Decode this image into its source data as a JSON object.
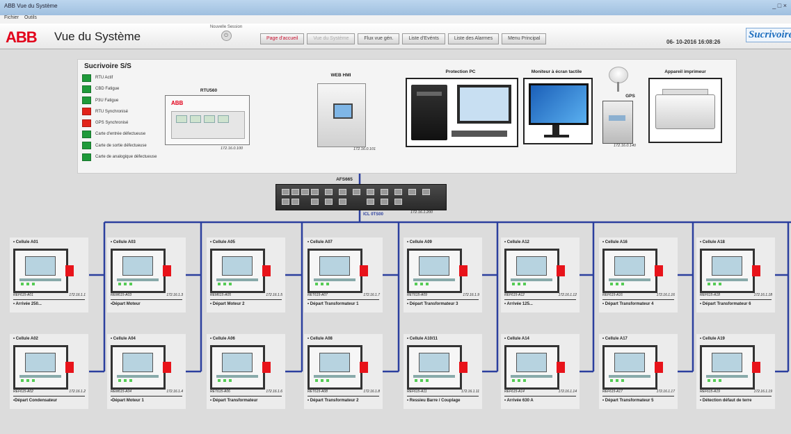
{
  "window": {
    "title": "ABB Vue du Système",
    "controls": "_ □ ×"
  },
  "menu": {
    "items": [
      "Fichier",
      "Outils"
    ]
  },
  "header": {
    "logo": "ABB",
    "title": "Vue du Système",
    "login_label": "Nouvelle Session",
    "datetime": "06- 10-2016 16:08:26",
    "brand": "Sucrivoire"
  },
  "nav": [
    {
      "label": "Page d'accueil",
      "state": "active"
    },
    {
      "label": "Vue du Système",
      "state": "dim"
    },
    {
      "label": "Flux vue gén.",
      "state": "normal"
    },
    {
      "label": "Liste d'Evénts",
      "state": "normal"
    },
    {
      "label": "Liste des Alarmes",
      "state": "normal"
    },
    {
      "label": "Menu Principal",
      "state": "normal"
    }
  ],
  "status_panel": {
    "title": "Sucrivoire S/S",
    "items": [
      {
        "label": "RTU Actif",
        "color": "#1f9a3a"
      },
      {
        "label": "CBD Fatigue",
        "color": "#1f9a3a"
      },
      {
        "label": "P3U Fatigue",
        "color": "#1f9a3a"
      },
      {
        "label": "RTU Synchronisé",
        "color": "#e2231a"
      },
      {
        "label": "GPS Synchronisé",
        "color": "#e2231a"
      },
      {
        "label": "Carte d'entrée défectueuse",
        "color": "#1f9a3a"
      },
      {
        "label": "Carte de sortie défectueuse",
        "color": "#1f9a3a"
      },
      {
        "label": "Carte de analogique défectueuse",
        "color": "#1f9a3a"
      }
    ]
  },
  "devices": {
    "rtu": {
      "title": "RTU560",
      "ip": "172.16.0.100",
      "logo": "ABB"
    },
    "hmi": {
      "title": "WEB HMI",
      "ip": "172.16.0.101"
    },
    "pc": {
      "title": "Protection PC"
    },
    "touch": {
      "title": "Moniteur à écran tactile"
    },
    "gps": {
      "title": "GPS",
      "ip": "172.16.0.140"
    },
    "printer": {
      "title": "Appareil imprimeur"
    },
    "switch": {
      "title": "AFS665",
      "label": "ICL 0TS00",
      "ip": "172.16.1.200"
    }
  },
  "cells": [
    {
      "header": "• Cellule A01",
      "id": "REF615-A01",
      "ip": "172.16.1.1",
      "desc": "• Arrivée 250..."
    },
    {
      "header": "• Cellule A03",
      "id": "REM615-A03",
      "ip": "172.16.1.3",
      "desc": "•Départ Moteur"
    },
    {
      "header": "• Cellule A05",
      "id": "REM615-A05",
      "ip": "172.16.1.5",
      "desc": "• Départ Moteur 2"
    },
    {
      "header": "• Cellule A07",
      "id": "RET615-A07",
      "ip": "172.16.1.7",
      "desc": "• Départ Transformateur 1"
    },
    {
      "header": "• Cellule A09",
      "id": "RET615-A09",
      "ip": "172.16.1.9",
      "desc": "• Départ Transformateur 3"
    },
    {
      "header": "• Cellule A12",
      "id": "REF615-A12",
      "ip": "172.16.1.12",
      "desc": "• Arrivée 125..."
    },
    {
      "header": "• Cellule A16",
      "id": "REF615-A16",
      "ip": "172.16.1.16",
      "desc": "• Départ Transformateur 4"
    },
    {
      "header": "• Cellule A18",
      "id": "REF615-A18",
      "ip": "172.16.1.18",
      "desc": "• Départ Transformateur 6"
    },
    {
      "header": "• Cellule A02",
      "id": "REF615-A02",
      "ip": "172.16.1.2",
      "desc": "•Départ Condensateur"
    },
    {
      "header": "• Cellule A04",
      "id": "REM615-A04",
      "ip": "172.16.1.4",
      "desc": "•Départ Moteur 1"
    },
    {
      "header": "• Cellule A06",
      "id": "RET615-A06",
      "ip": "172.16.1.6",
      "desc": "• Départ Transformateur"
    },
    {
      "header": "• Cellule A08",
      "id": "RET615-A08",
      "ip": "172.16.1.8",
      "desc": "• Départ Transformateur 2"
    },
    {
      "header": "• Cellule A10/11",
      "id": "REF615-A11",
      "ip": "172.16.1.11",
      "desc": "• Ressieu Barre / Couplage"
    },
    {
      "header": "• Cellule A14",
      "id": "REF615-A14",
      "ip": "172.16.1.14",
      "desc": "• Arrivée 630 A"
    },
    {
      "header": "• Cellule A17",
      "id": "REF615-A17",
      "ip": "172.16.1.17",
      "desc": "• Départ Transformateur 5"
    },
    {
      "header": "• Cellule A19",
      "id": "REF615-A19",
      "ip": "172.16.1.19",
      "desc": "• Détection défaut de terre"
    }
  ]
}
